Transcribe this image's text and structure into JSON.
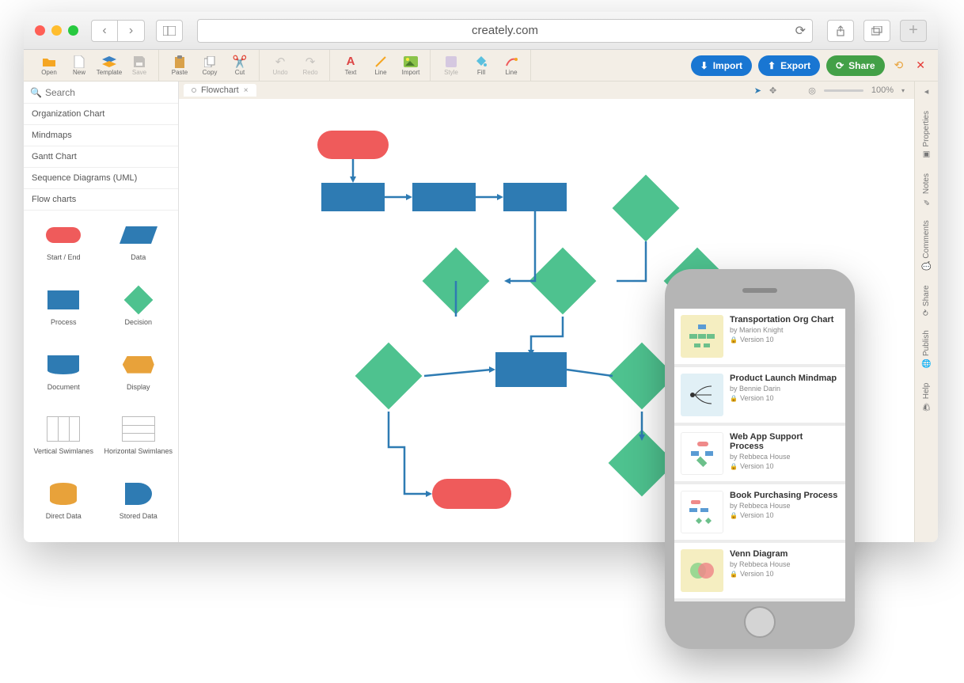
{
  "browser": {
    "url": "creately.com"
  },
  "toolbar": {
    "open": "Open",
    "new": "New",
    "template": "Template",
    "save": "Save",
    "paste": "Paste",
    "copy": "Copy",
    "cut": "Cut",
    "undo": "Undo",
    "redo": "Redo",
    "text": "Text",
    "line": "Line",
    "import_img": "Import",
    "style": "Style",
    "fill": "Fill",
    "line2": "Line",
    "import_btn": "Import",
    "export_btn": "Export",
    "share_btn": "Share"
  },
  "search": {
    "placeholder": "Search"
  },
  "categories": [
    "Organization Chart",
    "Mindmaps",
    "Gantt Chart",
    "Sequence Diagrams (UML)",
    "Flow charts"
  ],
  "shapes": [
    {
      "label": "Start / End"
    },
    {
      "label": "Data"
    },
    {
      "label": "Process"
    },
    {
      "label": "Decision"
    },
    {
      "label": "Document"
    },
    {
      "label": "Display"
    },
    {
      "label": "Vertical Swimlanes"
    },
    {
      "label": "Horizontal Swimlanes"
    },
    {
      "label": "Direct Data"
    },
    {
      "label": "Stored Data"
    }
  ],
  "tab": {
    "name": "Flowchart"
  },
  "zoom": {
    "value": "100%"
  },
  "rail": {
    "properties": "Properties",
    "notes": "Notes",
    "comments": "Comments",
    "share": "Share",
    "publish": "Publish",
    "help": "Help"
  },
  "phone_docs": [
    {
      "title": "Transportation Org Chart",
      "by": "by Marion Knight",
      "ver": "Version 10",
      "thumb_bg": "#f5eec1"
    },
    {
      "title": "Product Launch Mindmap",
      "by": "by Bennie Darin",
      "ver": "Version 10",
      "thumb_bg": "#e1f0f6"
    },
    {
      "title": "Web App Support Process",
      "by": "by Rebbeca House",
      "ver": "Version 10",
      "thumb_bg": "#ffffff"
    },
    {
      "title": "Book Purchasing Process",
      "by": "by Rebbeca House",
      "ver": "Version 10",
      "thumb_bg": "#ffffff"
    },
    {
      "title": "Venn Diagram",
      "by": "by Rebbeca House",
      "ver": "Version 10",
      "thumb_bg": "#f5eec1"
    }
  ]
}
